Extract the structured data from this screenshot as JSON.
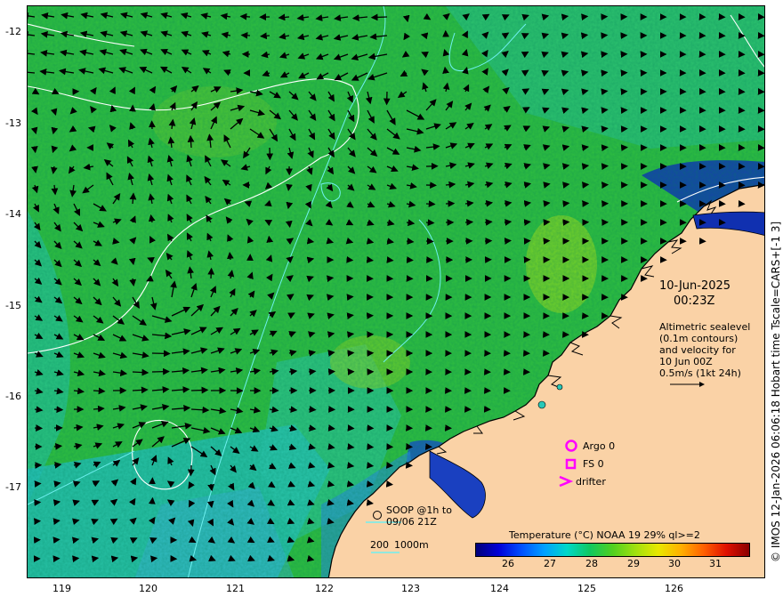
{
  "map": {
    "date": "10-Jun-2025",
    "time": "00:23Z",
    "lat_ticks": [
      "-12",
      "-13",
      "-14",
      "-15",
      "-16",
      "-17"
    ],
    "lon_ticks": [
      "119",
      "120",
      "121",
      "122",
      "123",
      "124",
      "125",
      "126"
    ],
    "info_lines": [
      "Altimetric sealevel",
      "(0.1m contours)",
      "and velocity for",
      "10 Jun 00Z",
      "0.5m/s (1kt 24h)"
    ],
    "legend": {
      "argo": "Argo 0",
      "fs": "FS 0",
      "drifter": "drifter",
      "soop_line1": "SOOP @1h to",
      "soop_line2": "09/06 21Z",
      "bathy_200": "200",
      "bathy_1000": "1000m"
    },
    "colorbar": {
      "title": "Temperature (°C) NOAA 19 29% ql>=2",
      "ticks": [
        "26",
        "27",
        "28",
        "29",
        "30",
        "31"
      ],
      "colors": [
        "#00007a",
        "#0000d8",
        "#0050ff",
        "#00a0ff",
        "#00d8c8",
        "#10c860",
        "#50d020",
        "#a0e010",
        "#e8e800",
        "#ffb000",
        "#ff6000",
        "#e01000",
        "#8a0000"
      ]
    },
    "copyright": "© IMOS 12-Jan-2026 06:06:18 Hobart time Tscale=CARS+[-1 3]",
    "colors": {
      "land": "#fad2a6",
      "sea_green": "#2fbf3f",
      "sea_cyan": "#27c8b8",
      "sea_blue": "#0a56d6",
      "contour_white": "#ffffff",
      "isobath_cyan": "#6ff0f0",
      "marker_magenta": "#ff00ff"
    }
  }
}
